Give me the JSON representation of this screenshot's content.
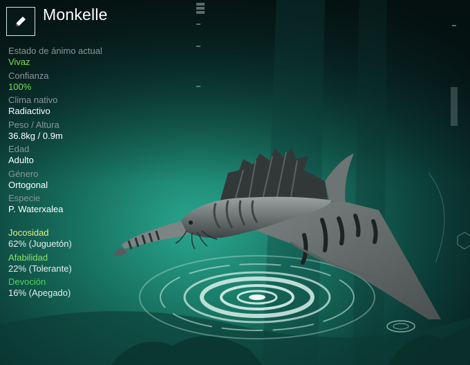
{
  "creature": {
    "name": "Monkelle"
  },
  "stats": [
    {
      "label": "Estado de ánimo actual",
      "value": "Vivaz"
    },
    {
      "label": "Confianza",
      "value": "100%"
    },
    {
      "label": "Clima nativo",
      "value": "Radiactivo"
    },
    {
      "label": "Peso / Altura",
      "value": "36.8kg / 0.9m"
    },
    {
      "label": "Edad",
      "value": "Adulto"
    },
    {
      "label": "Género",
      "value": "Ortogonal"
    },
    {
      "label": "Especie",
      "value": "P. Waterxalea"
    }
  ],
  "traits": [
    {
      "label": "Jocosidad",
      "value": "62% (Juguetón)",
      "color": "#e6ee7a"
    },
    {
      "label": "Afabilidad",
      "value": "22% (Tolerante)",
      "color": "#8be36a"
    },
    {
      "label": "Devoción",
      "value": "16% (Apegado)",
      "color": "#4fd35a"
    }
  ],
  "colors": {
    "accent_value": "#7be05a",
    "label_gray": "#8a9695"
  }
}
